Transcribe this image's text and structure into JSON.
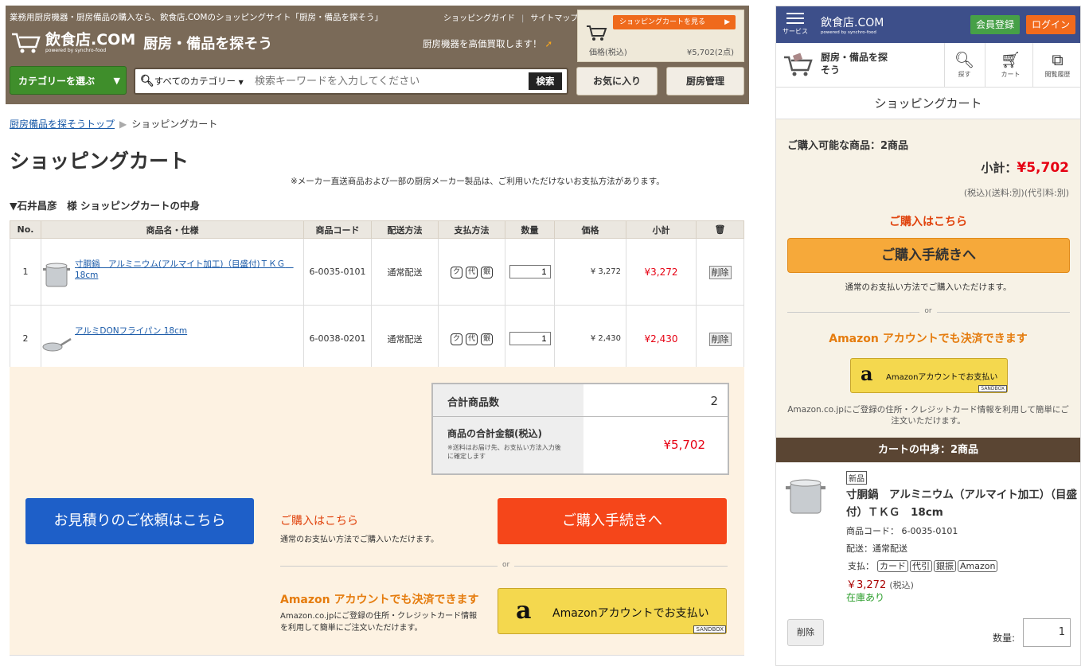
{
  "header": {
    "top_text": "業務用厨房機器・厨房備品の購入なら、飲食店.COMのショッピングサイト「厨房・備品を探そう」",
    "links": [
      "ショッピングガイド",
      "サイトマップ"
    ],
    "site_name": "飲食店.COM",
    "powered": "powered by synchro-food",
    "tagline": "厨房・備品を探そう",
    "buyback": "厨房機器を高価買取します！",
    "minicart": {
      "view": "ショッピングカートを見る",
      "price_label": "価格(税込)",
      "amount": "¥5,702(2点)"
    },
    "category_button": "カテゴリーを選ぶ",
    "search_category": "すべてのカテゴリー",
    "search_placeholder": "検索キーワードを入力してください",
    "search_button": "検索",
    "favorites": "お気に入り",
    "kitchen": "厨房管理"
  },
  "breadcrumb": {
    "home": "厨房備品を探そうトップ",
    "current": "ショッピングカート"
  },
  "page_title": "ショッピングカート",
  "notice": "※メーカー直送商品および一部の厨房メーカー製品は、ご利用いただけないお支払方法があります。",
  "owner": "▼石井昌彦　様 ショッピングカートの中身",
  "table": {
    "headers": [
      "No.",
      "商品名・仕様",
      "商品コード",
      "配送方法",
      "支払方法",
      "数量",
      "価格",
      "小計"
    ],
    "pay_marks": [
      "ク",
      "代",
      "銀"
    ],
    "delete": "削除",
    "rows": [
      {
        "no": "1",
        "name": "寸胴鍋　アルミニウム(アルマイト加工)（目盛付)ＴＫＧ　18cm",
        "code": "6-0035-0101",
        "ship": "通常配送",
        "qty": "1",
        "price": "¥ 3,272",
        "subtotal": "¥3,272"
      },
      {
        "no": "2",
        "name": "アルミDONフライパン 18cm",
        "code": "6-0038-0201",
        "ship": "通常配送",
        "qty": "1",
        "price": "¥ 2,430",
        "subtotal": "¥2,430"
      }
    ]
  },
  "totals": {
    "count_label": "合計商品数",
    "count": "2",
    "sum_label": "商品の合計金額(税込)",
    "sum_note": "※送料はお届け先、お支払い方法入力後に確定します",
    "sum": "¥5,702"
  },
  "actions": {
    "estimate": "お見積りのご依頼はこちら",
    "buy_here": "ご購入はこちら",
    "buy_note": "通常のお支払い方法でご購入いただけます。",
    "buy": "ご購入手続きへ",
    "or": "or",
    "amazon_head": "Amazon アカウントでも決済できます",
    "amazon_note": "Amazon.co.jpにご登録の住所・クレジットカード情報を利用して簡単にご注文いただけます。",
    "amazon_btn": "Amazonアカウントでお支払い",
    "sandbox": "SANDBOX"
  },
  "sp": {
    "menu": "サービス",
    "site_name": "飲食店.COM",
    "powered": "powered by synchro-food",
    "register": "会員登録",
    "login": "ログイン",
    "nav_title": "厨房・備品を探そう",
    "nav": [
      "探す",
      "カート",
      "閲覧履歴"
    ],
    "title": "ショッピングカート",
    "available": "ご購入可能な商品：2商品",
    "subtotal_label": "小計：",
    "subtotal": "¥5,702",
    "tax": "(税込)(送料:別)(代引料:別)",
    "buy_here": "ご購入はこちら",
    "buy": "ご購入手続きへ",
    "buy_note": "通常のお支払い方法でご購入いただけます。",
    "or": "or",
    "amazon_head": "Amazon アカウントでも決済できます",
    "amazon_btn": "Amazonアカウントでお支払い",
    "sandbox": "SANDBOX",
    "amazon_note": "Amazon.co.jpにご登録の住所・クレジットカード情報を利用して簡単にご注文いただけます。",
    "cart_bar": "カートの中身：2商品",
    "item": {
      "badge": "新品",
      "name": "寸胴鍋　アルミニウム（アルマイト加工）（目盛付）ＴＫＧ　18cm",
      "code": "商品コード： 6-0035-0101",
      "ship_label": "配送：",
      "ship": "通常配送",
      "pay_label": "支払：",
      "pays": [
        "カード",
        "代引",
        "銀振",
        "Amazon"
      ],
      "price": "￥3,272",
      "tax": "(税込)",
      "stock": "在庫あり",
      "delete": "削除",
      "qty_label": "数量:",
      "qty": "1"
    }
  }
}
